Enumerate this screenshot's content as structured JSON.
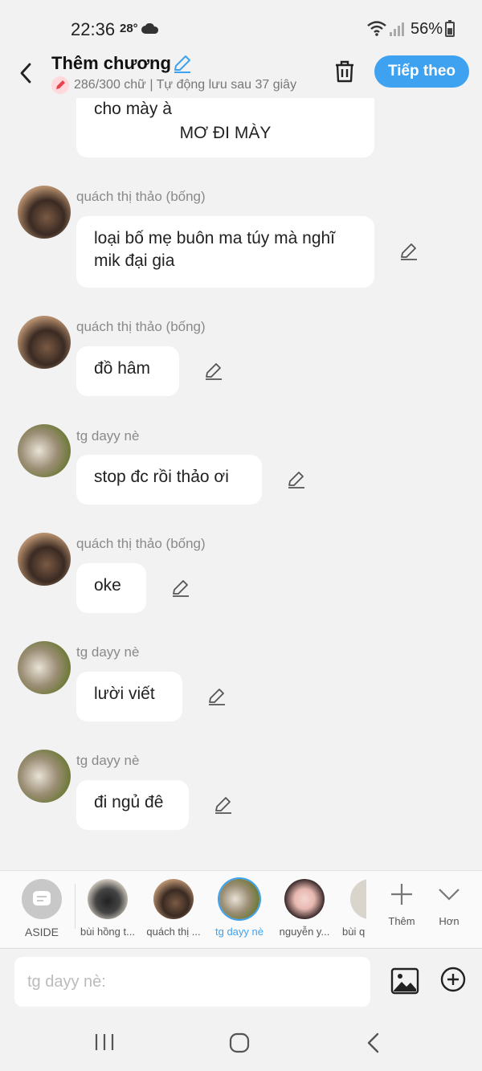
{
  "status": {
    "time": "22:36",
    "temp": "28°",
    "battery": "56%"
  },
  "header": {
    "title": "Thêm chương",
    "subtitle": "286/300 chữ | Tự động lưu sau 37 giây",
    "next_label": "Tiếp theo"
  },
  "chat": {
    "top_bubble": {
      "line1": "cho mày à",
      "line2": "MƠ ĐI MÀY"
    },
    "messages": [
      {
        "name": "quách thị thảo (bống)",
        "text": "loại bố mẹ buôn ma túy mà nghĩ mik đại gia"
      },
      {
        "name": "quách thị thảo (bống)",
        "text": "đồ hâm"
      },
      {
        "name": "tg dayy nè",
        "text": "stop đc rồi thảo ơi"
      },
      {
        "name": "quách thị thảo (bống)",
        "text": "oke"
      },
      {
        "name": "tg dayy nè",
        "text": "lười viết"
      },
      {
        "name": "tg dayy nè",
        "text": "đi ngủ đê"
      }
    ]
  },
  "characters": {
    "aside": "ASIDE",
    "items": [
      "bùi hồng t...",
      "quách thị ...",
      "tg dayy nè",
      "nguyễn y...",
      "bùi q"
    ],
    "add_label": "Thêm",
    "more_label": "Hơn"
  },
  "input": {
    "placeholder": "tg dayy nè:"
  }
}
